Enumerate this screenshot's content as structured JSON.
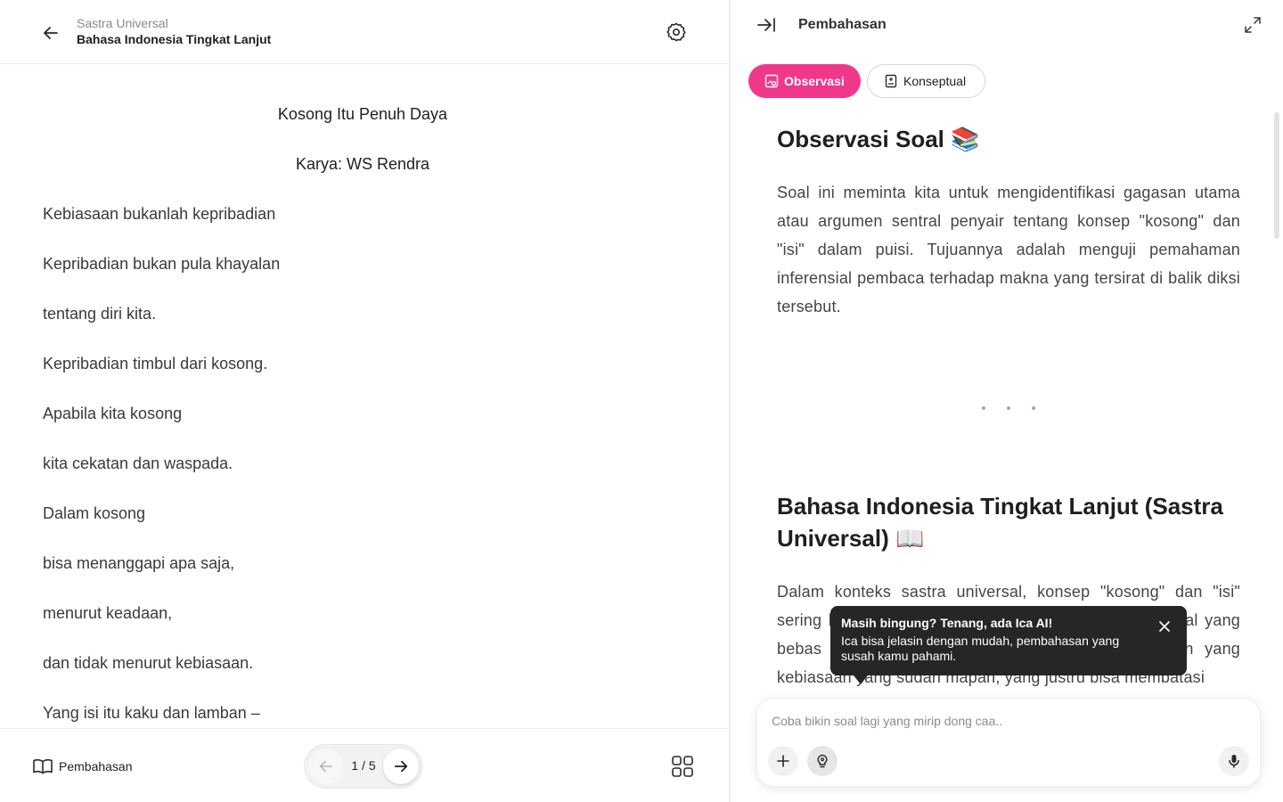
{
  "header": {
    "breadcrumb_sub": "Sastra Universal",
    "breadcrumb_title": "Bahasa Indonesia Tingkat Lanjut"
  },
  "poem": {
    "title": "Kosong Itu Penuh Daya",
    "author": "Karya: WS Rendra",
    "lines": [
      "Kebiasaan bukanlah kepribadian",
      "Kepribadian bukan pula khayalan",
      "tentang diri kita.",
      "Kepribadian timbul dari kosong.",
      "Apabila kita kosong",
      "kita cekatan dan waspada.",
      "Dalam kosong",
      "bisa menanggapi apa saja,",
      "menurut keadaan,",
      "dan tidak menurut kebiasaan.",
      "Yang isi itu kaku dan lamban –"
    ]
  },
  "footer": {
    "discussion_label": "Pembahasan",
    "page_indicator": "1 / 5"
  },
  "panel": {
    "title": "Pembahasan",
    "tabs": [
      {
        "label": "Observasi",
        "active": true
      },
      {
        "label": "Konseptual",
        "active": false
      }
    ],
    "section1_heading": "Observasi Soal 📚",
    "section1_text": "Soal ini meminta kita untuk mengidentifikasi gagasan utama atau argumen sentral penyair tentang konsep \"kosong\" dan \"isi\" dalam puisi. Tujuannya adalah menguji pemahaman inferensial pembaca terhadap makna yang tersirat di balik diksi tersebut.",
    "section2_heading": "Bahasa Indonesia Tingkat Lanjut (Sastra Universal) 📖",
    "section2_text": "Dalam konteks sastra universal, konsep \"kosong\" dan \"isi\" sering bisa diinterpretasikan sebagai sesuatu yang ideal yang bebas dari prasangka, ide-ide baku, atau kebiasaan yang kebiasaan yang sudah mapan, yang justru bisa membatasi"
  },
  "tooltip": {
    "title": "Masih bingung? Tenang, ada Ica AI!",
    "body": "Ica bisa jelasin dengan mudah, pembahasan yang susah kamu pahami."
  },
  "chat": {
    "placeholder": "Coba bikin soal lagi yang mirip dong caa.."
  },
  "colors": {
    "accent": "#f0388a",
    "tooltip_bg": "#262626"
  },
  "icons": [
    "arrow-left-icon",
    "gear-icon",
    "book-open-icon",
    "grid-icon",
    "collapse-right-icon",
    "expand-icon",
    "image-search-icon",
    "document-icon",
    "close-icon",
    "plus-icon",
    "lightbulb-icon",
    "microphone-icon"
  ]
}
